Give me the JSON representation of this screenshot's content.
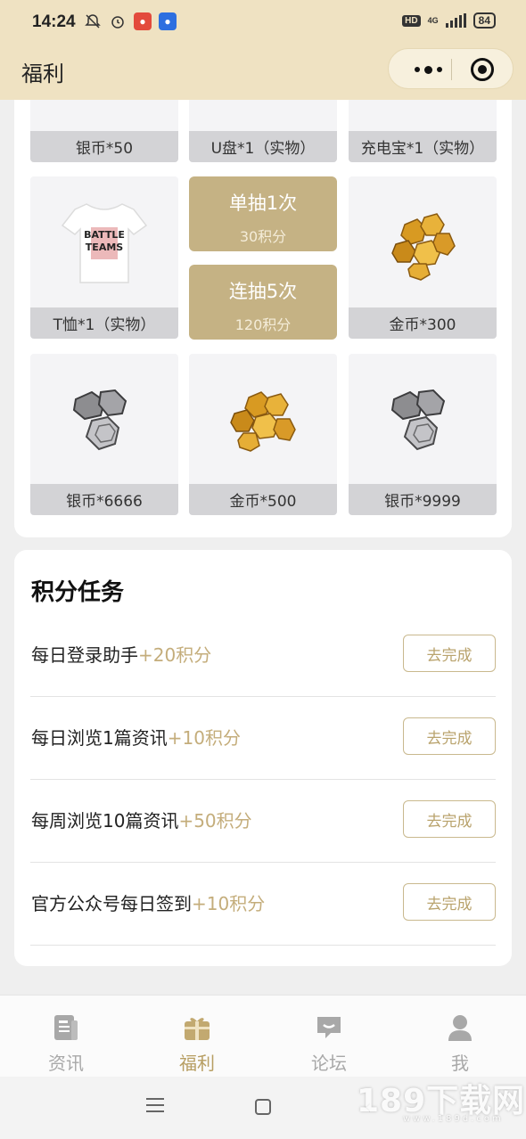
{
  "status_bar": {
    "time": "14:24",
    "hd": "HD",
    "network": "4G",
    "battery": "84"
  },
  "header": {
    "title": "福利"
  },
  "prizes": {
    "row1": [
      "银币*50",
      "U盘*1（实物）",
      "充电宝*1（实物）"
    ],
    "tshirt": "T恤*1（实物）",
    "gold300": "金币*300",
    "silver6666": "银币*6666",
    "gold500": "金币*500",
    "silver9999": "银币*9999",
    "tshirt_print": "BATTLE TEAMS"
  },
  "draw": {
    "single_label": "单抽1次",
    "single_cost": "30积分",
    "multi_label": "连抽5次",
    "multi_cost": "120积分"
  },
  "tasks": {
    "title": "积分任务",
    "items": [
      {
        "name": "每日登录助手",
        "points": "+20积分",
        "button": "去完成"
      },
      {
        "name": "每日浏览1篇资讯",
        "points": "+10积分",
        "button": "去完成"
      },
      {
        "name": "每周浏览10篇资讯",
        "points": "+50积分",
        "button": "去完成"
      },
      {
        "name": "官方公众号每日签到",
        "points": "+10积分",
        "button": "去完成"
      }
    ]
  },
  "tabbar": {
    "items": [
      {
        "label": "资讯",
        "icon": "news-icon"
      },
      {
        "label": "福利",
        "icon": "gift-icon"
      },
      {
        "label": "论坛",
        "icon": "chat-icon"
      },
      {
        "label": "我",
        "icon": "user-icon"
      }
    ],
    "active": "福利"
  },
  "watermark": {
    "text": "189下载网",
    "sub": "www.189d.com"
  },
  "colors": {
    "header_bg": "#efe2c2",
    "accent": "#c5b284",
    "points": "#c4ad7b"
  }
}
